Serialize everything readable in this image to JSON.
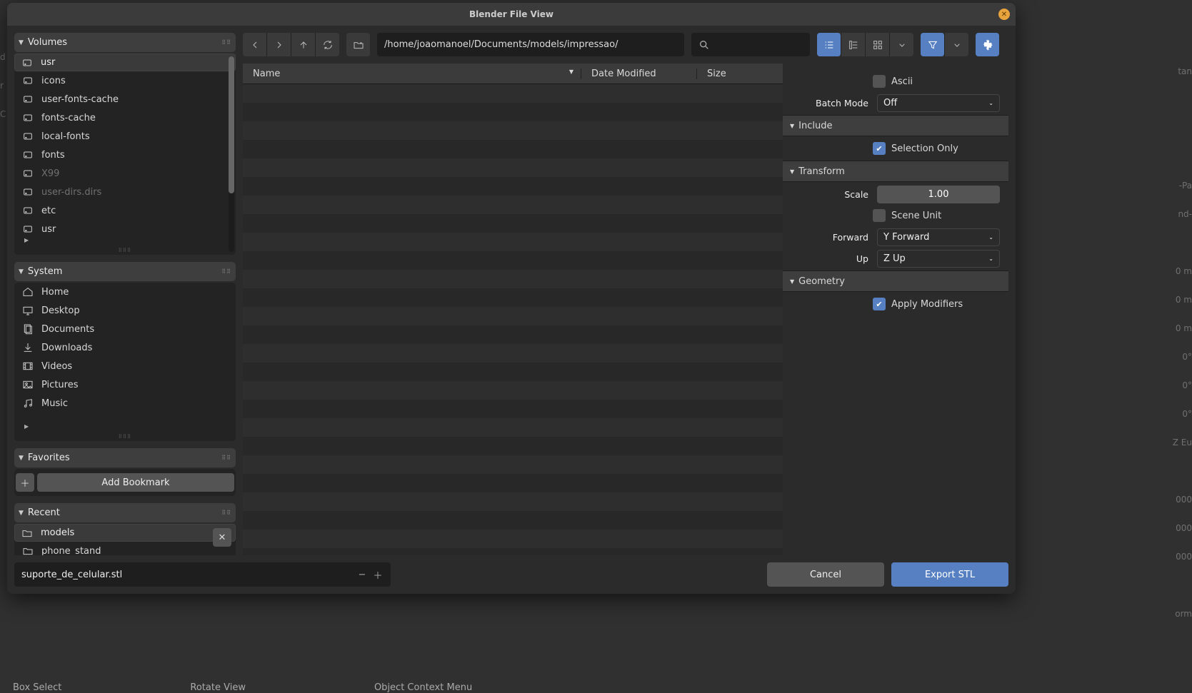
{
  "window_title": "Blender File View",
  "toolbar": {
    "path": "/home/joaomanoel/Documents/models/impressao/",
    "search": ""
  },
  "sidebar": {
    "volumes": {
      "title": "Volumes",
      "items": [
        {
          "label": "usr",
          "icon": "disk",
          "sel": true
        },
        {
          "label": "icons",
          "icon": "disk",
          "sel": false
        },
        {
          "label": "user-fonts-cache",
          "icon": "disk",
          "sel": false
        },
        {
          "label": "fonts-cache",
          "icon": "disk",
          "sel": false
        },
        {
          "label": "local-fonts",
          "icon": "disk",
          "sel": false
        },
        {
          "label": "fonts",
          "icon": "disk",
          "sel": false
        },
        {
          "label": "X99",
          "icon": "disk",
          "sel": false,
          "disabled": true
        },
        {
          "label": "user-dirs.dirs",
          "icon": "disk",
          "sel": false,
          "disabled": true
        },
        {
          "label": "etc",
          "icon": "disk",
          "sel": false
        },
        {
          "label": "usr",
          "icon": "disk",
          "sel": false
        }
      ]
    },
    "system": {
      "title": "System",
      "items": [
        {
          "label": "Home",
          "icon": "home"
        },
        {
          "label": "Desktop",
          "icon": "desktop"
        },
        {
          "label": "Documents",
          "icon": "documents"
        },
        {
          "label": "Downloads",
          "icon": "downloads"
        },
        {
          "label": "Videos",
          "icon": "videos"
        },
        {
          "label": "Pictures",
          "icon": "pictures"
        },
        {
          "label": "Music",
          "icon": "music"
        }
      ]
    },
    "favorites": {
      "title": "Favorites",
      "add_bookmark_label": "Add Bookmark"
    },
    "recent": {
      "title": "Recent",
      "items": [
        {
          "label": "models",
          "icon": "folder",
          "sel": true
        },
        {
          "label": "phone_stand",
          "icon": "folder",
          "sel": false
        }
      ]
    }
  },
  "file_list": {
    "columns": {
      "name": "Name",
      "date_modified": "Date Modified",
      "size": "Size"
    },
    "rows": []
  },
  "options": {
    "ascii_label": "Ascii",
    "ascii_checked": false,
    "batch_mode_label": "Batch Mode",
    "batch_mode_value": "Off",
    "include_label": "Include",
    "selection_only_label": "Selection Only",
    "selection_only_checked": true,
    "transform_label": "Transform",
    "scale_label": "Scale",
    "scale_value": "1.00",
    "scene_unit_label": "Scene Unit",
    "scene_unit_checked": false,
    "forward_label": "Forward",
    "forward_value": "Y Forward",
    "up_label": "Up",
    "up_value": "Z Up",
    "geometry_label": "Geometry",
    "apply_modifiers_label": "Apply Modifiers",
    "apply_modifiers_checked": true
  },
  "footer": {
    "filename": "suporte_de_celular.stl",
    "cancel_label": "Cancel",
    "confirm_label": "Export STL"
  },
  "underlay": {
    "box_select": "Box Select",
    "rotate_view": "Rotate View",
    "object_context_menu": "Object Context Menu"
  }
}
